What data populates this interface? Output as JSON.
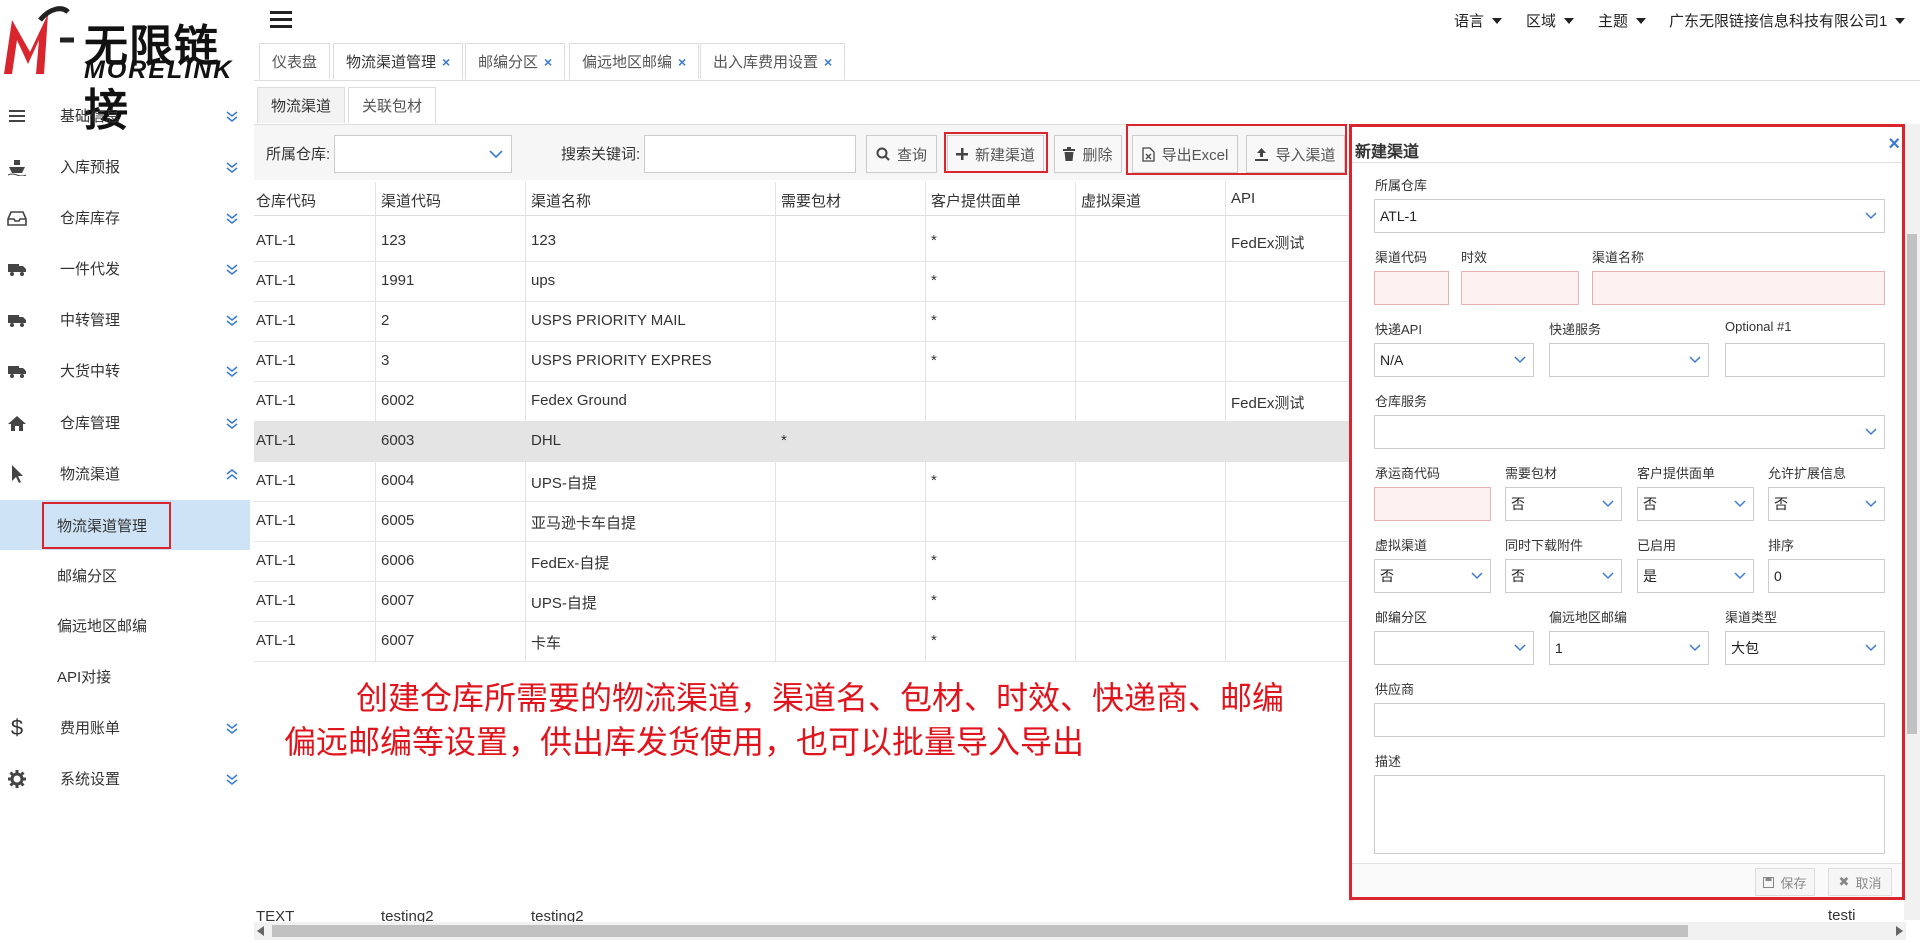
{
  "brand": {
    "chinese": "无限链接",
    "english": "MORELINK"
  },
  "sidebar": {
    "items": [
      {
        "label": "基础信息",
        "icon": "bars-icon"
      },
      {
        "label": "入库预报",
        "icon": "ship-icon"
      },
      {
        "label": "仓库库存",
        "icon": "inbox-icon"
      },
      {
        "label": "一件代发",
        "icon": "truck-icon"
      },
      {
        "label": "中转管理",
        "icon": "truck-icon"
      },
      {
        "label": "大货中转",
        "icon": "truck-icon"
      },
      {
        "label": "仓库管理",
        "icon": "home-icon"
      },
      {
        "label": "物流渠道",
        "icon": "cursor-icon"
      }
    ],
    "subitems": [
      "物流渠道管理",
      "邮编分区",
      "偏远地区邮编",
      "API对接"
    ],
    "bottom_items": [
      {
        "label": "费用账单",
        "icon": "dollar-icon"
      },
      {
        "label": "系统设置",
        "icon": "gear-icon"
      }
    ]
  },
  "topbar": {
    "language": "语言",
    "region": "区域",
    "theme": "主题",
    "company": "广东无限链接信息科技有限公司1"
  },
  "tabs": [
    "仪表盘",
    "物流渠道管理",
    "邮编分区",
    "偏远地区邮编",
    "出入库费用设置"
  ],
  "subtabs": [
    "物流渠道",
    "关联包材"
  ],
  "toolbar": {
    "warehouse_label": "所属仓库:",
    "keyword_label": "搜索关键词:",
    "query": "查询",
    "new_channel": "新建渠道",
    "delete": "删除",
    "export": "导出Excel",
    "import": "导入渠道"
  },
  "table": {
    "headers": [
      "仓库代码",
      "渠道代码",
      "渠道名称",
      "需要包材",
      "客户提供面单",
      "虚拟渠道",
      "API"
    ],
    "rows": [
      [
        "ATL-1",
        "123",
        "123",
        "",
        "*",
        "",
        "FedEx测试"
      ],
      [
        "ATL-1",
        "1991",
        "ups",
        "",
        "*",
        "",
        ""
      ],
      [
        "ATL-1",
        "2",
        "USPS PRIORITY MAIL",
        "",
        "*",
        "",
        ""
      ],
      [
        "ATL-1",
        "3",
        "USPS PRIORITY EXPRES",
        "",
        "*",
        "",
        ""
      ],
      [
        "ATL-1",
        "6002",
        "Fedex Ground",
        "",
        "",
        "",
        "FedEx测试"
      ],
      [
        "ATL-1",
        "6003",
        "DHL",
        "*",
        "",
        "",
        ""
      ],
      [
        "ATL-1",
        "6004",
        "UPS-自提",
        "",
        "*",
        "",
        ""
      ],
      [
        "ATL-1",
        "6005",
        "亚马逊卡车自提",
        "",
        "",
        "",
        ""
      ],
      [
        "ATL-1",
        "6006",
        "FedEx-自提",
        "",
        "*",
        "",
        ""
      ],
      [
        "ATL-1",
        "6007",
        "UPS-自提",
        "",
        "*",
        "",
        ""
      ],
      [
        "ATL-1",
        "6007",
        "卡车",
        "",
        "*",
        "",
        ""
      ]
    ],
    "bottom_row": [
      "TEXT",
      "testing2",
      "testing2",
      "testi"
    ]
  },
  "annotation": {
    "line1": "创建仓库所需要的物流渠道，渠道名、包材、时效、快递商、邮编",
    "line2": "偏远邮编等设置，供出库发货使用，也可以批量导入导出"
  },
  "panel": {
    "title": "新建渠道",
    "close": "×",
    "warehouse_label": "所属仓库",
    "warehouse_value": "ATL-1",
    "channel_code_label": "渠道代码",
    "timeliness_label": "时效",
    "channel_name_label": "渠道名称",
    "express_api_label": "快递API",
    "express_api_value": "N/A",
    "express_service_label": "快递服务",
    "optional1_label": "Optional #1",
    "warehouse_service_label": "仓库服务",
    "carrier_code_label": "承运商代码",
    "need_packaging_label": "需要包材",
    "need_packaging_value": "否",
    "customer_label_label": "客户提供面单",
    "customer_label_value": "否",
    "allow_ext_label": "允许扩展信息",
    "allow_ext_value": "否",
    "virtual_label": "虚拟渠道",
    "virtual_value": "否",
    "download_attach_label": "同时下载附件",
    "download_attach_value": "否",
    "enabled_label": "已启用",
    "enabled_value": "是",
    "sort_label": "排序",
    "sort_value": "0",
    "zip_zone_label": "邮编分区",
    "remote_zip_label": "偏远地区邮编",
    "remote_zip_value": "1",
    "channel_type_label": "渠道类型",
    "channel_type_value": "大包",
    "supplier_label": "供应商",
    "description_label": "描述",
    "save": "保存",
    "cancel": "取消"
  },
  "colors": {
    "highlight_red": "#d9252d",
    "annotation_red": "#e0141c",
    "active_sub": "#cfe3f6",
    "link_blue": "#3b7bd4"
  }
}
